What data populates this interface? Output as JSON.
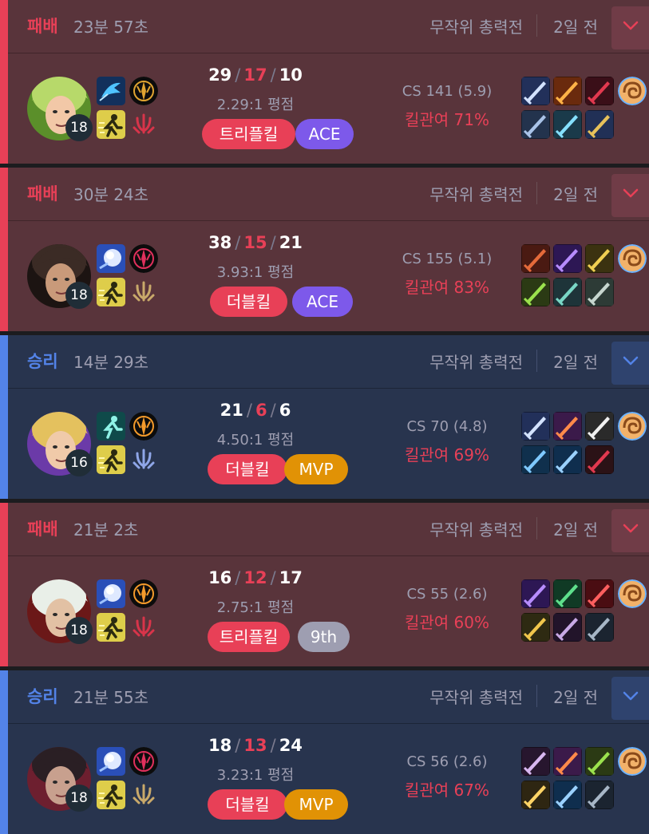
{
  "colors": {
    "loss_accent": "#e84057",
    "win_accent": "#5383e8",
    "loss_bg": "#59343b",
    "win_bg": "#28344e",
    "ace_badge": "#7d59ea",
    "mvp_badge": "#e19205",
    "gray_badge": "#9e9eb1"
  },
  "matches": [
    {
      "outcome": "loss",
      "result": "패배",
      "duration": "23분 57초",
      "mode": "무작위 총력전",
      "ago": "2일 전",
      "level": "18",
      "kills": "29",
      "deaths": "17",
      "assists": "10",
      "ratio": "2.29:1 평점",
      "badges": [
        {
          "label": "트리플킬",
          "kind": "red"
        },
        {
          "label": "ACE",
          "kind": "ace"
        }
      ],
      "cs": "CS 141 (5.9)",
      "kp": "킬관여 71%",
      "champion_icon": "champion-green-hair-portrait",
      "spell_icons": [
        "spell-blue-dash-icon",
        "spell-yellow-runner-icon"
      ],
      "rune_icons": [
        "rune-gold-keystone-icon",
        "rune-red-secondary-icon"
      ],
      "item_icons": [
        "item-blades-icon",
        "item-flame-sword-icon",
        "item-red-blade-icon",
        "item-claws-icon",
        "item-dagger-icon",
        "item-shield-emblem-icon"
      ]
    },
    {
      "outcome": "loss",
      "result": "패배",
      "duration": "30분 24초",
      "mode": "무작위 총력전",
      "ago": "2일 전",
      "level": "18",
      "kills": "38",
      "deaths": "15",
      "assists": "21",
      "ratio": "3.93:1 평점",
      "badges": [
        {
          "label": "더블킬",
          "kind": "red"
        },
        {
          "label": "ACE",
          "kind": "ace"
        }
      ],
      "cs": "CS 155 (5.1)",
      "kp": "킬관여 83%",
      "champion_icon": "champion-bearded-man-portrait",
      "spell_icons": [
        "spell-snowball-icon",
        "spell-yellow-runner-icon"
      ],
      "rune_icons": [
        "rune-red-keystone-icon",
        "rune-gold-secondary-icon"
      ],
      "item_icons": [
        "item-axe-icon",
        "item-purple-spear-icon",
        "item-gold-blade-icon",
        "item-green-blade-icon",
        "item-gun-icon",
        "item-pickaxe-icon"
      ]
    },
    {
      "outcome": "win",
      "result": "승리",
      "duration": "14분 29초",
      "mode": "무작위 총력전",
      "ago": "2일 전",
      "level": "16",
      "kills": "21",
      "deaths": "6",
      "assists": "6",
      "ratio": "4.50:1 평점",
      "badges": [
        {
          "label": "더블킬",
          "kind": "red"
        },
        {
          "label": "MVP",
          "kind": "mvp"
        }
      ],
      "cs": "CS 70 (4.8)",
      "kp": "킬관여 69%",
      "champion_icon": "champion-blonde-hair-portrait",
      "spell_icons": [
        "spell-ghost-runner-icon",
        "spell-yellow-runner-icon"
      ],
      "rune_icons": [
        "rune-orange-keystone-icon",
        "rune-blue-secondary-icon"
      ],
      "item_icons": [
        "item-blades-icon",
        "item-orange-dagger-icon",
        "item-crossed-swords-icon",
        "item-blue-dagger-icon",
        "item-blue-spear-icon",
        "item-red-boots-icon"
      ]
    },
    {
      "outcome": "loss",
      "result": "패배",
      "duration": "21분 2초",
      "mode": "무작위 총력전",
      "ago": "2일 전",
      "level": "18",
      "kills": "16",
      "deaths": "12",
      "assists": "17",
      "ratio": "2.75:1 평점",
      "badges": [
        {
          "label": "트리플킬",
          "kind": "red"
        },
        {
          "label": "9th",
          "kind": "gray"
        }
      ],
      "cs": "CS 55 (2.6)",
      "kp": "킬관여 60%",
      "champion_icon": "champion-white-hair-portrait",
      "spell_icons": [
        "spell-snowball-icon",
        "spell-yellow-runner-icon"
      ],
      "rune_icons": [
        "rune-orange-keystone-icon",
        "rune-red-secondary-icon"
      ],
      "item_icons": [
        "item-purple-spear-icon",
        "item-green-cloak-icon",
        "item-red-orb-icon",
        "item-gold-bow-icon",
        "item-dark-blade-icon",
        "item-dark-boots-icon"
      ]
    },
    {
      "outcome": "win",
      "result": "승리",
      "duration": "21분 55초",
      "mode": "무작위 총력전",
      "ago": "2일 전",
      "level": "18",
      "kills": "18",
      "deaths": "13",
      "assists": "24",
      "ratio": "3.23:1 평점",
      "badges": [
        {
          "label": "더블킬",
          "kind": "red"
        },
        {
          "label": "MVP",
          "kind": "mvp"
        }
      ],
      "cs": "CS 56 (2.6)",
      "kp": "킬관여 67%",
      "champion_icon": "champion-dark-hair-portrait",
      "spell_icons": [
        "spell-snowball-icon",
        "spell-yellow-runner-icon"
      ],
      "rune_icons": [
        "rune-red-keystone-icon",
        "rune-gold-secondary-icon"
      ],
      "item_icons": [
        "item-dark-spear-icon",
        "item-orange-dagger-icon",
        "item-green-blade-icon",
        "item-gold-gun-icon",
        "item-blue-spear-icon",
        "item-dark-boots-icon"
      ]
    }
  ],
  "ward_icon": "ward-totem-icon"
}
